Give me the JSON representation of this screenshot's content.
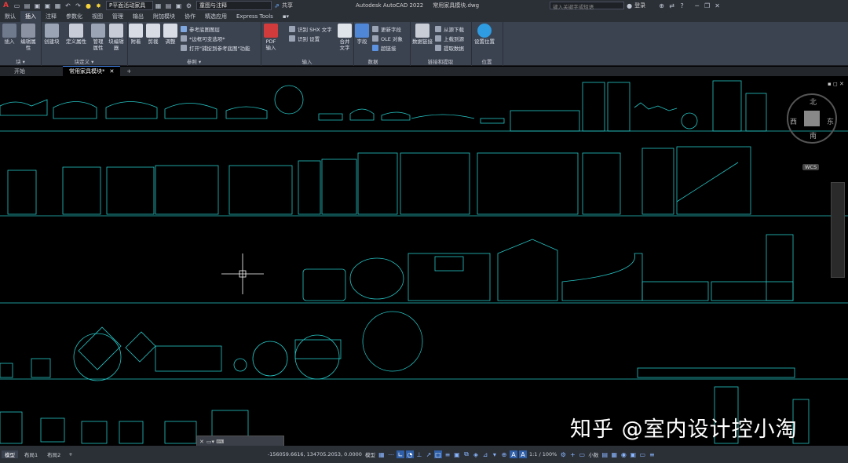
{
  "titlebar": {
    "app_letter": "A",
    "workspace": "P平面活动家具",
    "layer": "童图与注释",
    "share": "共享",
    "app_title": "Autodesk AutoCAD 2022",
    "file_title": "常用家具模块.dwg",
    "search_placeholder": "键入关键字或短语",
    "login": "登录"
  },
  "ribbon_tabs": [
    "默认",
    "插入",
    "注释",
    "参数化",
    "视图",
    "管理",
    "输出",
    "附加模块",
    "协作",
    "精选应用",
    "Express Tools",
    "▪▾"
  ],
  "ribbon_active_tab": "插入",
  "ribbon": {
    "panels": [
      {
        "title": "块 ▾",
        "buttons": [
          "插入",
          "编辑属性"
        ]
      },
      {
        "title": "块定义 ▾",
        "buttons": [
          "创建块",
          "定义属性",
          "管理属性",
          "块编辑器"
        ]
      },
      {
        "title": "参照 ▾",
        "buttons": [
          "附着",
          "剪裁",
          "调整"
        ],
        "rows": [
          "参考底图图层",
          "*边框可变选项*",
          "打开\"捕捉到参考底图\"功能"
        ]
      },
      {
        "title": "输入",
        "buttons": [
          "PDF输入"
        ],
        "rows": [
          "识别 SHX 文字",
          "识别 设置"
        ]
      },
      {
        "title": "数据",
        "buttons": [
          "合并文字",
          "字段"
        ],
        "rows": [
          "更新字段",
          "OLE 对象",
          "超链接"
        ]
      },
      {
        "title": "链接和提取",
        "buttons": [
          "数据链接"
        ],
        "rows": [
          "从源下载",
          "上载到源",
          "提取数据"
        ]
      },
      {
        "title": "位置",
        "buttons": [
          "设置位置"
        ]
      }
    ]
  },
  "doc_tabs": [
    "开始",
    "常用家具模块*"
  ],
  "doc_active": "常用家具模块*",
  "viewcube": {
    "north": "北",
    "south": "南",
    "east": "东",
    "west": "西",
    "wcs": "WCS"
  },
  "statusbar": {
    "layout_tabs": [
      "模型",
      "布局1",
      "布局2"
    ],
    "coords": "-156059.6616, 134705.2053, 0.0000",
    "model": "模型",
    "scale": "1:1 / 100%",
    "units": "小数"
  },
  "watermark": "知乎 @室内设计控小淘",
  "colors": {
    "cad_line": "#26c6c6",
    "bg": "#000000",
    "ribbon": "#3b4250",
    "title": "#2b2f36"
  }
}
